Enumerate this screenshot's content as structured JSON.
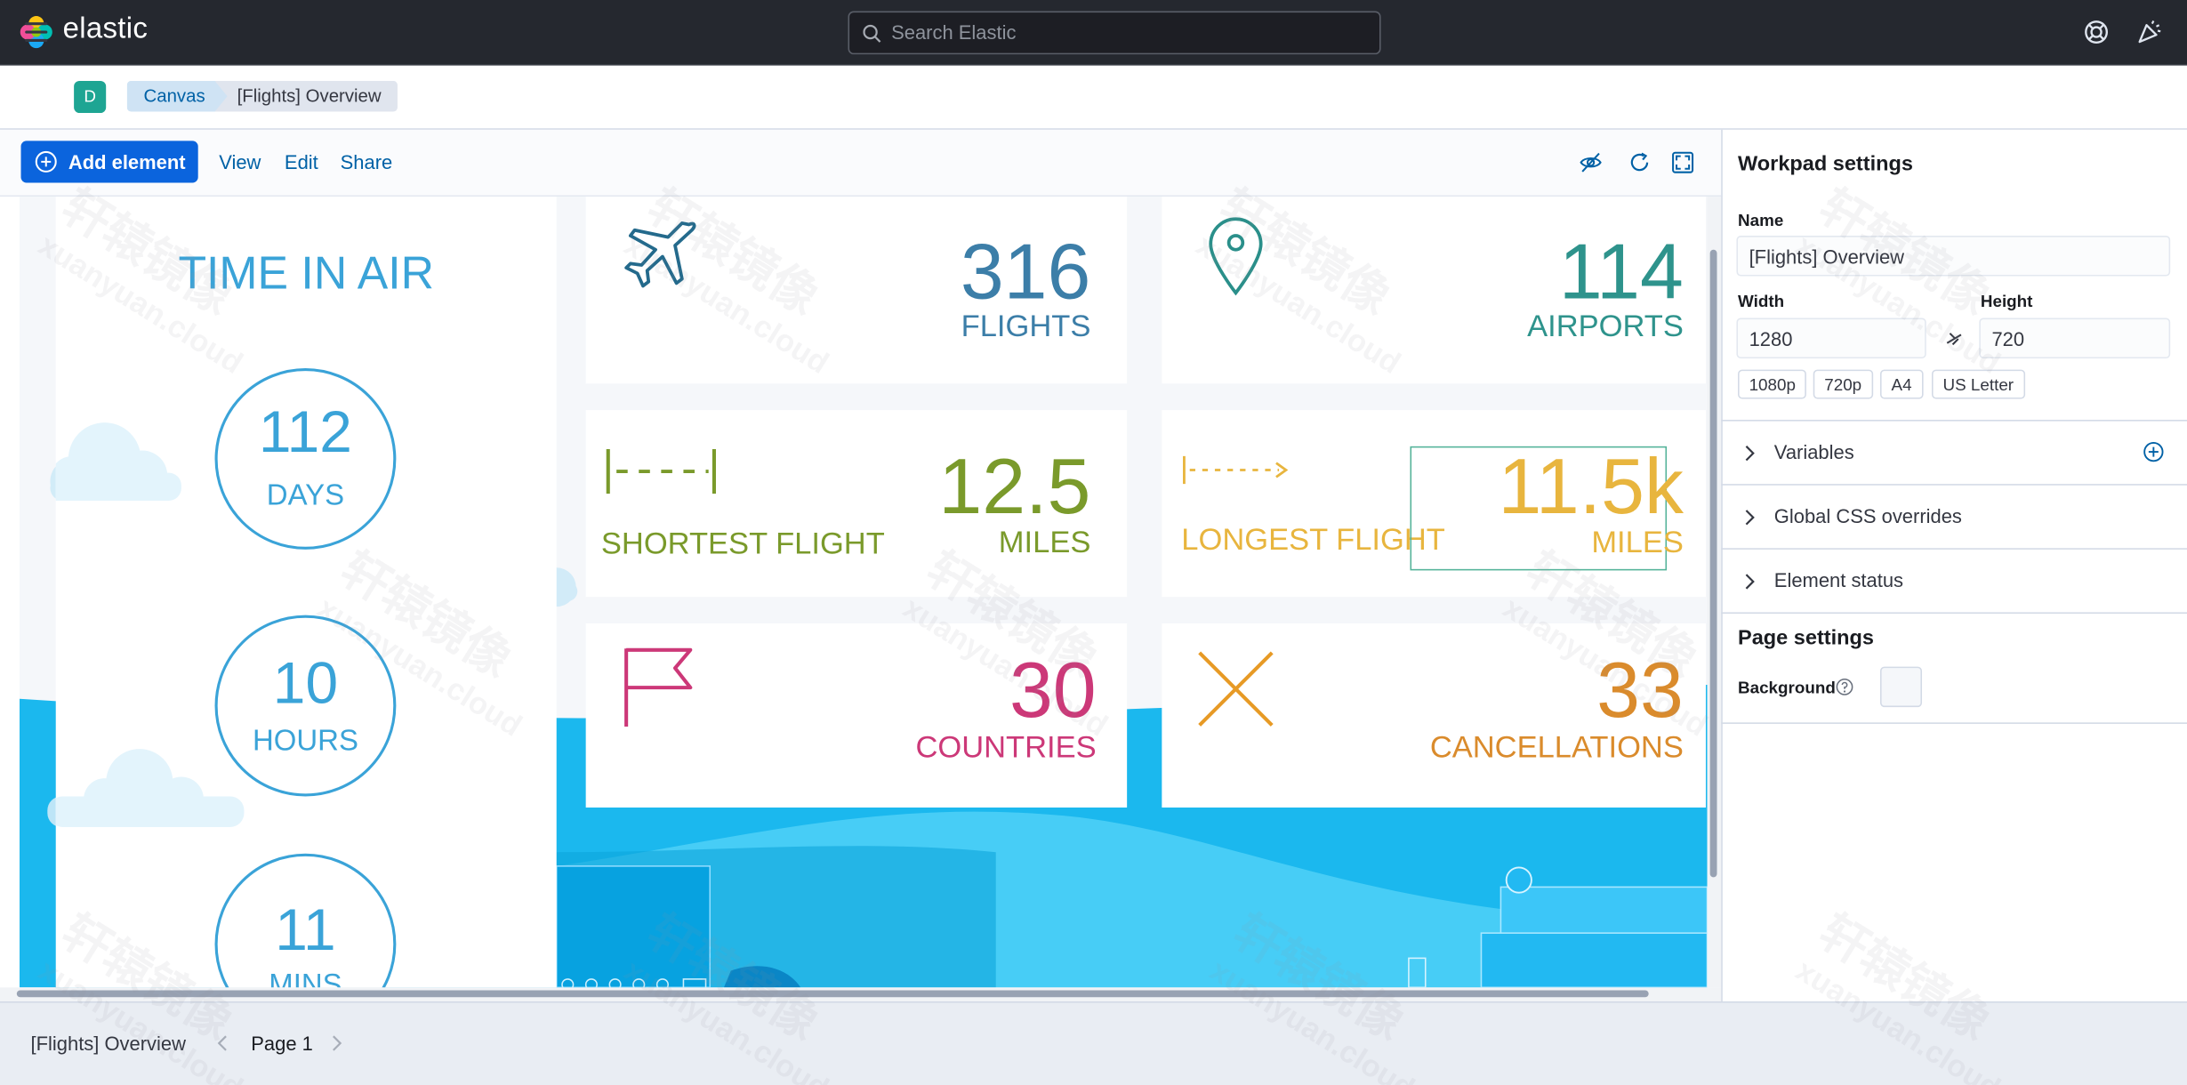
{
  "header": {
    "brand": "elastic",
    "search_placeholder": "Search Elastic",
    "help_icon": "help-icon",
    "news_icon": "newsfeed-icon"
  },
  "nav": {
    "space_initial": "D",
    "breadcrumbs": [
      "Canvas",
      "[Flights] Overview"
    ]
  },
  "toolbar": {
    "add_element": "Add element",
    "view": "View",
    "edit": "Edit",
    "share": "Share"
  },
  "workpad": {
    "time_in_air": {
      "title": "TIME IN AIR",
      "days_value": "112",
      "days_label": "DAYS",
      "hours_value": "10",
      "hours_label": "HOURS",
      "mins_value": "11",
      "mins_label": "MINS"
    },
    "flights": {
      "value": "316",
      "label": "FLIGHTS",
      "color": "#3c7ea8"
    },
    "airports": {
      "value": "114",
      "label": "AIRPORTS",
      "color": "#2e938c"
    },
    "shortest": {
      "title": "SHORTEST FLIGHT",
      "value": "12.5",
      "unit": "MILES",
      "color": "#7a9a2b"
    },
    "longest": {
      "title": "LONGEST FLIGHT",
      "value": "11.5k",
      "unit": "MILES",
      "color": "#e8b53e"
    },
    "countries": {
      "value": "30",
      "label": "COUNTRIES",
      "color": "#cc3878"
    },
    "cancellations": {
      "value": "33",
      "label": "CANCELLATIONS",
      "color": "#da8b2c"
    }
  },
  "workpad_settings": {
    "title": "Workpad settings",
    "name_label": "Name",
    "name_value": "[Flights] Overview",
    "width_label": "Width",
    "width_value": "1280",
    "height_label": "Height",
    "height_value": "720",
    "presets": [
      "1080p",
      "720p",
      "A4",
      "US Letter"
    ],
    "sections": [
      "Variables",
      "Global CSS overrides",
      "Element status"
    ]
  },
  "page_settings": {
    "title": "Page settings",
    "background_label": "Background"
  },
  "footer": {
    "workpad_name": "[Flights] Overview",
    "page_label": "Page 1"
  },
  "watermark": {
    "cn": "轩辕镜像",
    "en": "xuanyuan.cloud"
  },
  "colors": {
    "header_bg": "#25282f",
    "accent": "#0b64dd",
    "sky_blue": "#1bb8ee"
  }
}
